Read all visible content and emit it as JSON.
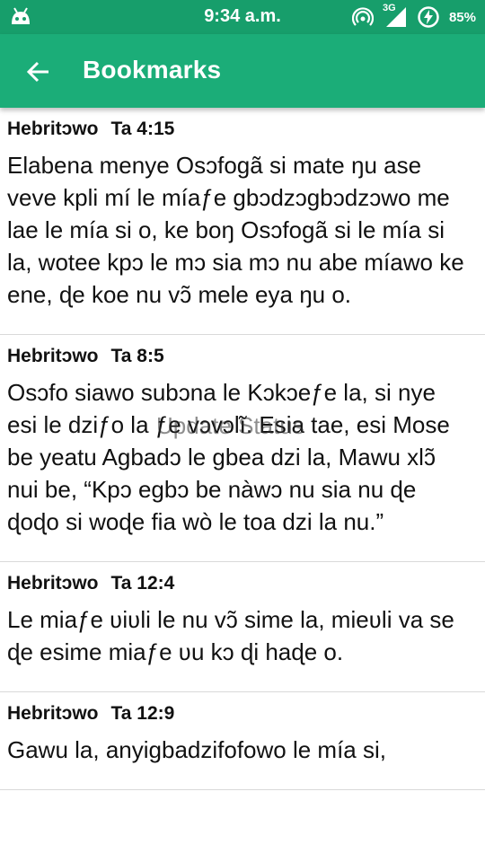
{
  "status_bar": {
    "time": "9:34 a.m.",
    "network_type": "3G",
    "battery_percent": "85%",
    "icons": [
      "android-icon",
      "hotspot-icon",
      "signal-icon",
      "battery-charging-icon"
    ]
  },
  "app_bar": {
    "title": "Bookmarks",
    "back_icon": "arrow-left-icon",
    "color": "#1bad78"
  },
  "bookmarks": [
    {
      "book": "Hebritɔwo",
      "ref": "Ta 4:15",
      "text": "Elabena menye Osɔfogã si mate ŋu ase veve kpli mí le míaƒe gbɔdzɔgbɔdzɔwo me lae le mía si o, ke boŋ Osɔfogã si le mía si la, wotee kpɔ le mɔ sia mɔ nu abe míawo ke ene, ɖe koe nu vɔ̃ mele eya ŋu o."
    },
    {
      "book": "Hebritɔwo",
      "ref": "Ta 8:5",
      "text": "Osɔfo siawo subɔna le Kɔkɔeƒe la, si nye esi le dziƒo la ƒe vɔvɔlĩ. Esia tae, esi Mose be yeatu Agbadɔ le gbea dzi la, Mawu xlɔ̃ nui be, “Kpɔ egbɔ be nàwɔ nu sia nu ɖe ɖoɖo si woɖe fia wò le toa dzi la nu.”"
    },
    {
      "book": "Hebritɔwo",
      "ref": "Ta 12:4",
      "text": "Le miaƒe ʋiʋli le nu vɔ̃ sime la, mieʋli va se ɖe esime miaƒe ʋu kɔ ɖi haɖe o."
    },
    {
      "book": "Hebritɔwo",
      "ref": "Ta 12:9",
      "text": "Gawu la, anyigbadzifofowo le mía si,"
    }
  ],
  "toast": "Update Status"
}
